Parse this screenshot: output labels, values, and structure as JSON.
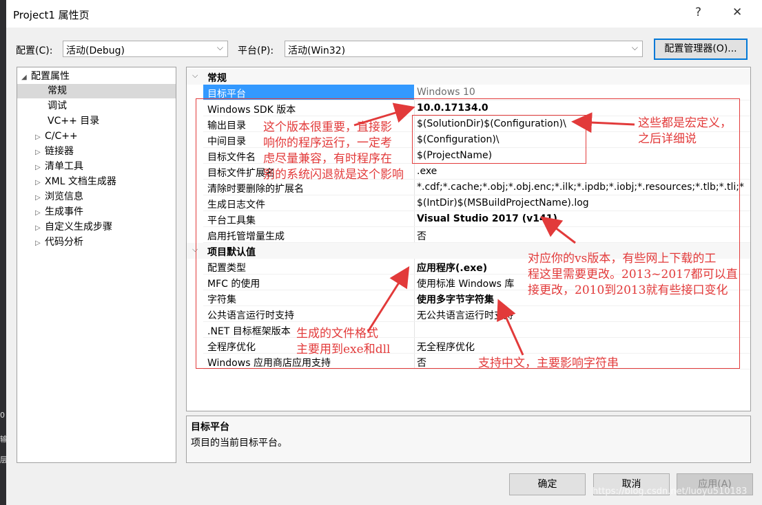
{
  "window": {
    "title": "Project1 属性页",
    "help": "?",
    "close": "✕"
  },
  "toolbar": {
    "config_label": "配置(C):",
    "config_value": "活动(Debug)",
    "platform_label": "平台(P):",
    "platform_value": "活动(Win32)",
    "config_manager": "配置管理器(O)..."
  },
  "tree": {
    "root": "配置属性",
    "items": [
      {
        "label": "常规",
        "selected": true
      },
      {
        "label": "调试"
      },
      {
        "label": "VC++ 目录"
      },
      {
        "label": "C/C++"
      },
      {
        "label": "链接器"
      },
      {
        "label": "清单工具"
      },
      {
        "label": "XML 文档生成器"
      },
      {
        "label": "浏览信息"
      },
      {
        "label": "生成事件"
      },
      {
        "label": "自定义生成步骤"
      },
      {
        "label": "代码分析"
      }
    ]
  },
  "grid": {
    "cat1": "常规",
    "rows1": [
      {
        "name": "目标平台",
        "value": "Windows 10"
      },
      {
        "name": "Windows SDK 版本",
        "value": "10.0.17134.0"
      },
      {
        "name": "输出目录",
        "value": "$(SolutionDir)$(Configuration)\\"
      },
      {
        "name": "中间目录",
        "value": "$(Configuration)\\"
      },
      {
        "name": "目标文件名",
        "value": "$(ProjectName)"
      },
      {
        "name": "目标文件扩展名",
        "value": ".exe"
      },
      {
        "name": "清除时要删除的扩展名",
        "value": "*.cdf;*.cache;*.obj;*.obj.enc;*.ilk;*.ipdb;*.iobj;*.resources;*.tlb;*.tli;*"
      },
      {
        "name": "生成日志文件",
        "value": "$(IntDir)$(MSBuildProjectName).log"
      },
      {
        "name": "平台工具集",
        "value": "Visual Studio 2017 (v141)"
      },
      {
        "name": "启用托管增量生成",
        "value": "否"
      }
    ],
    "cat2": "项目默认值",
    "rows2": [
      {
        "name": "配置类型",
        "value": "应用程序(.exe)"
      },
      {
        "name": "MFC 的使用",
        "value": "使用标准 Windows 库"
      },
      {
        "name": "字符集",
        "value": "使用多字节字符集"
      },
      {
        "name": "公共语言运行时支持",
        "value": "无公共语言运行时支持"
      },
      {
        "name": ".NET 目标框架版本",
        "value": ""
      },
      {
        "name": "全程序优化",
        "value": "无全程序优化"
      },
      {
        "name": "Windows 应用商店应用支持",
        "value": "否"
      }
    ]
  },
  "description": {
    "title": "目标平台",
    "text": "项目的当前目标平台。"
  },
  "buttons": {
    "ok": "确定",
    "cancel": "取消",
    "apply": "应用(A)"
  },
  "annotations": {
    "sdk_l1": "这个版本很重要，直接影",
    "sdk_l2": "响你的程序运行，一定考",
    "sdk_l3": "虑尽量兼容，有时程序在",
    "sdk_l4": "别的系统闪退就是这个影响",
    "macro_l1": "这些都是宏定义，",
    "macro_l2": "之后详细说",
    "vs_l1": "对应你的vs版本，有些网上下载的工",
    "vs_l2": "程这里需要更改。2013~2017都可以直",
    "vs_l3": "接更改，2010到2013就有些接口变化",
    "format_l1": "生成的文件格式",
    "format_l2": "主要用到exe和dll",
    "charset": "支持中文，主要影响字符串"
  },
  "left_strip": [
    "0",
    "输",
    "层"
  ],
  "watermark": "https://blog.csdn.net/luoyu510183",
  "colors": {
    "annotation": "#e23a3a",
    "selection": "#3399ff",
    "focus": "#0078d7"
  }
}
